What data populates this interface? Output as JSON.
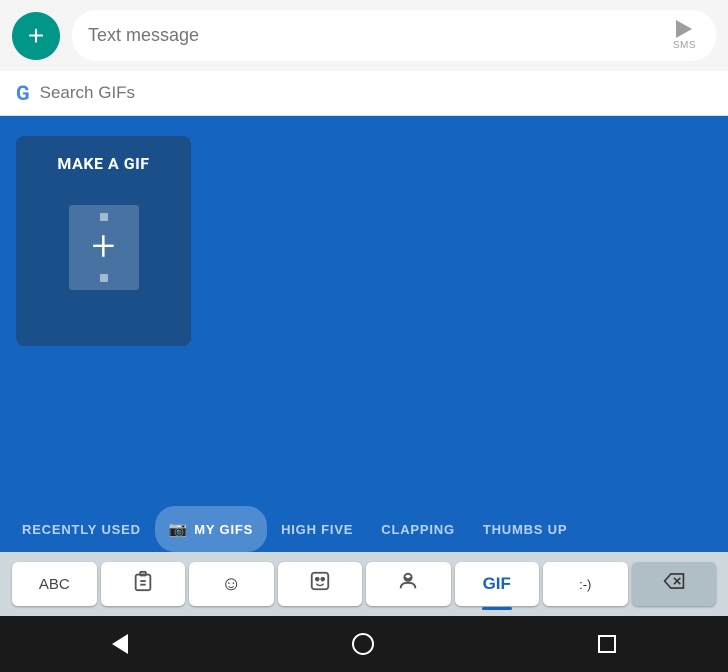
{
  "message_bar": {
    "placeholder": "Text message",
    "send_label": "SMS"
  },
  "search_bar": {
    "placeholder": "Search GIFs"
  },
  "make_gif": {
    "title": "MAKE A GIF"
  },
  "tabs": [
    {
      "id": "recently-used",
      "label": "RECENTLY USED",
      "active": false
    },
    {
      "id": "my-gifs",
      "label": "MY GIFS",
      "active": true,
      "has_icon": true
    },
    {
      "id": "high-five",
      "label": "HIGH FIVE",
      "active": false
    },
    {
      "id": "clapping",
      "label": "CLAPPING",
      "active": false
    },
    {
      "id": "thumbs-up",
      "label": "THUMBS UP",
      "active": false
    }
  ],
  "keyboard": {
    "keys": [
      {
        "id": "abc",
        "label": "ABC",
        "type": "abc"
      },
      {
        "id": "clipboard",
        "label": "📋",
        "type": "icon"
      },
      {
        "id": "emoji",
        "label": "☺",
        "type": "icon"
      },
      {
        "id": "sticker",
        "label": "🤖",
        "type": "icon"
      },
      {
        "id": "bitmoji",
        "label": "😀",
        "type": "icon"
      },
      {
        "id": "gif",
        "label": "GIF",
        "type": "gif"
      },
      {
        "id": "emoticon",
        "label": ":-)",
        "type": "icon"
      },
      {
        "id": "delete",
        "label": "⌫",
        "type": "delete"
      }
    ]
  },
  "nav_bar": {
    "back_label": "back",
    "home_label": "home",
    "recents_label": "recents"
  }
}
